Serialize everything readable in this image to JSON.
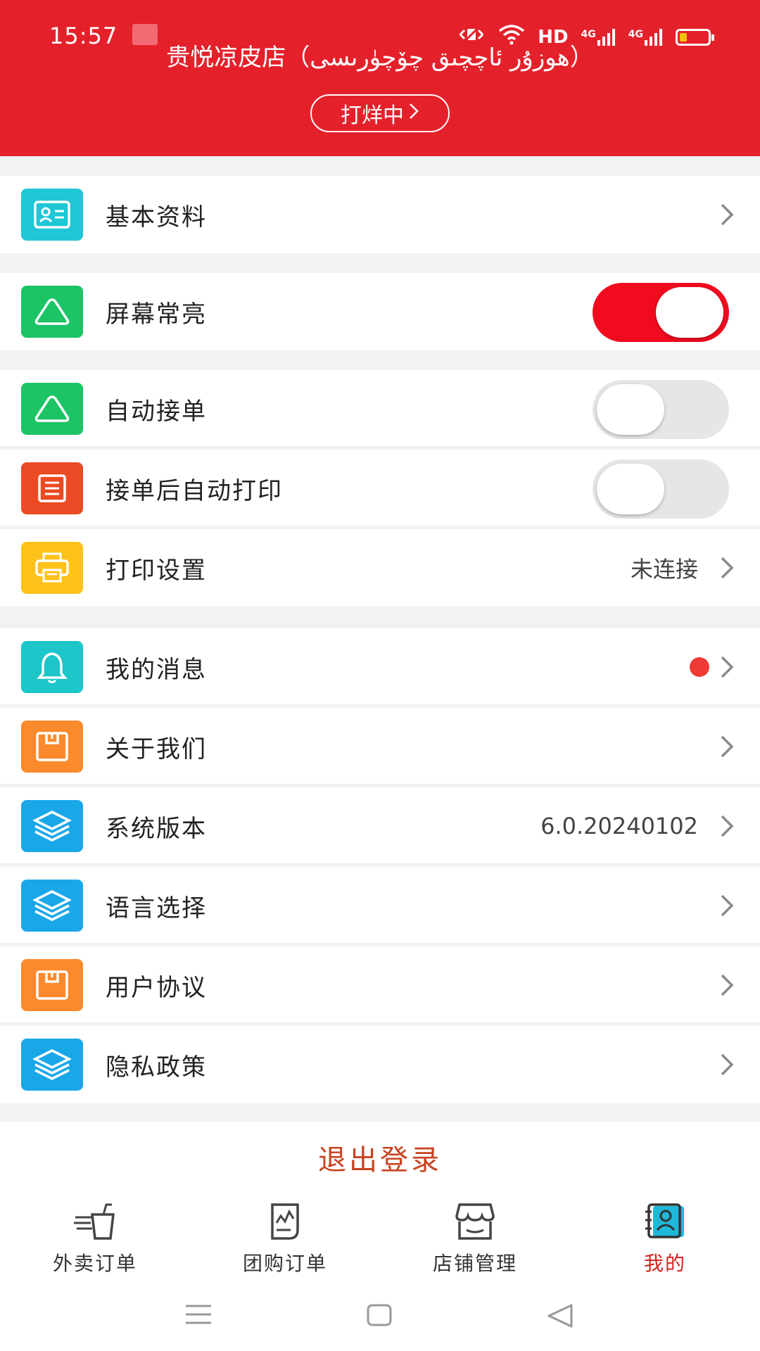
{
  "status_bar": {
    "time": "15:57",
    "network_label": "HD",
    "signal_1": "4G",
    "signal_2": "4G"
  },
  "header": {
    "store_name": "贵悦凉皮店（ھوزۇر ئاچچىق چۆچۈرىسى）",
    "printing_label": "打烊中",
    "colors": {
      "background": "#e4212b"
    }
  },
  "menu": {
    "basic_info": {
      "label": "基本资料",
      "icon": "id-card-icon"
    },
    "screen_on": {
      "label": "屏幕常亮",
      "icon": "triangle-icon",
      "enabled": true
    },
    "auto_accept": {
      "label": "自动接单",
      "icon": "triangle-icon",
      "enabled": false
    },
    "auto_print": {
      "label": "接单后自动打印",
      "icon": "receipt-icon",
      "enabled": false
    },
    "print_settings": {
      "label": "打印设置",
      "value": "未连接",
      "icon": "printer-icon"
    },
    "messages": {
      "label": "我的消息",
      "icon": "bell-icon",
      "has_unread": true
    },
    "about": {
      "label": "关于我们",
      "icon": "box-icon"
    },
    "version": {
      "label": "系统版本",
      "value": "6.0.20240102",
      "icon": "layers-icon"
    },
    "language": {
      "label": "语言选择",
      "icon": "layers-icon"
    },
    "agreement": {
      "label": "用户协议",
      "icon": "box-icon"
    },
    "privacy": {
      "label": "隐私政策",
      "icon": "layers-icon"
    }
  },
  "logout": {
    "label": "退出登录",
    "color": "#c7431f"
  },
  "tabbar": {
    "tabs": [
      {
        "label": "外卖订单",
        "icon": "takeout-cup-icon",
        "active": false
      },
      {
        "label": "团购订单",
        "icon": "document-icon",
        "active": false
      },
      {
        "label": "店铺管理",
        "icon": "store-icon",
        "active": false
      },
      {
        "label": "我的",
        "icon": "contact-book-icon",
        "active": true
      }
    ],
    "active_color": "#d8221f"
  },
  "colors": {
    "toggle_on": "#f10b1f",
    "tile_cyan": "#1ec6d6",
    "tile_green": "#1cc466",
    "tile_red": "#ec4a24",
    "tile_yellow": "#ffc21a",
    "tile_orange": "#fb8a2d",
    "tile_blue": "#1aa7e8"
  }
}
